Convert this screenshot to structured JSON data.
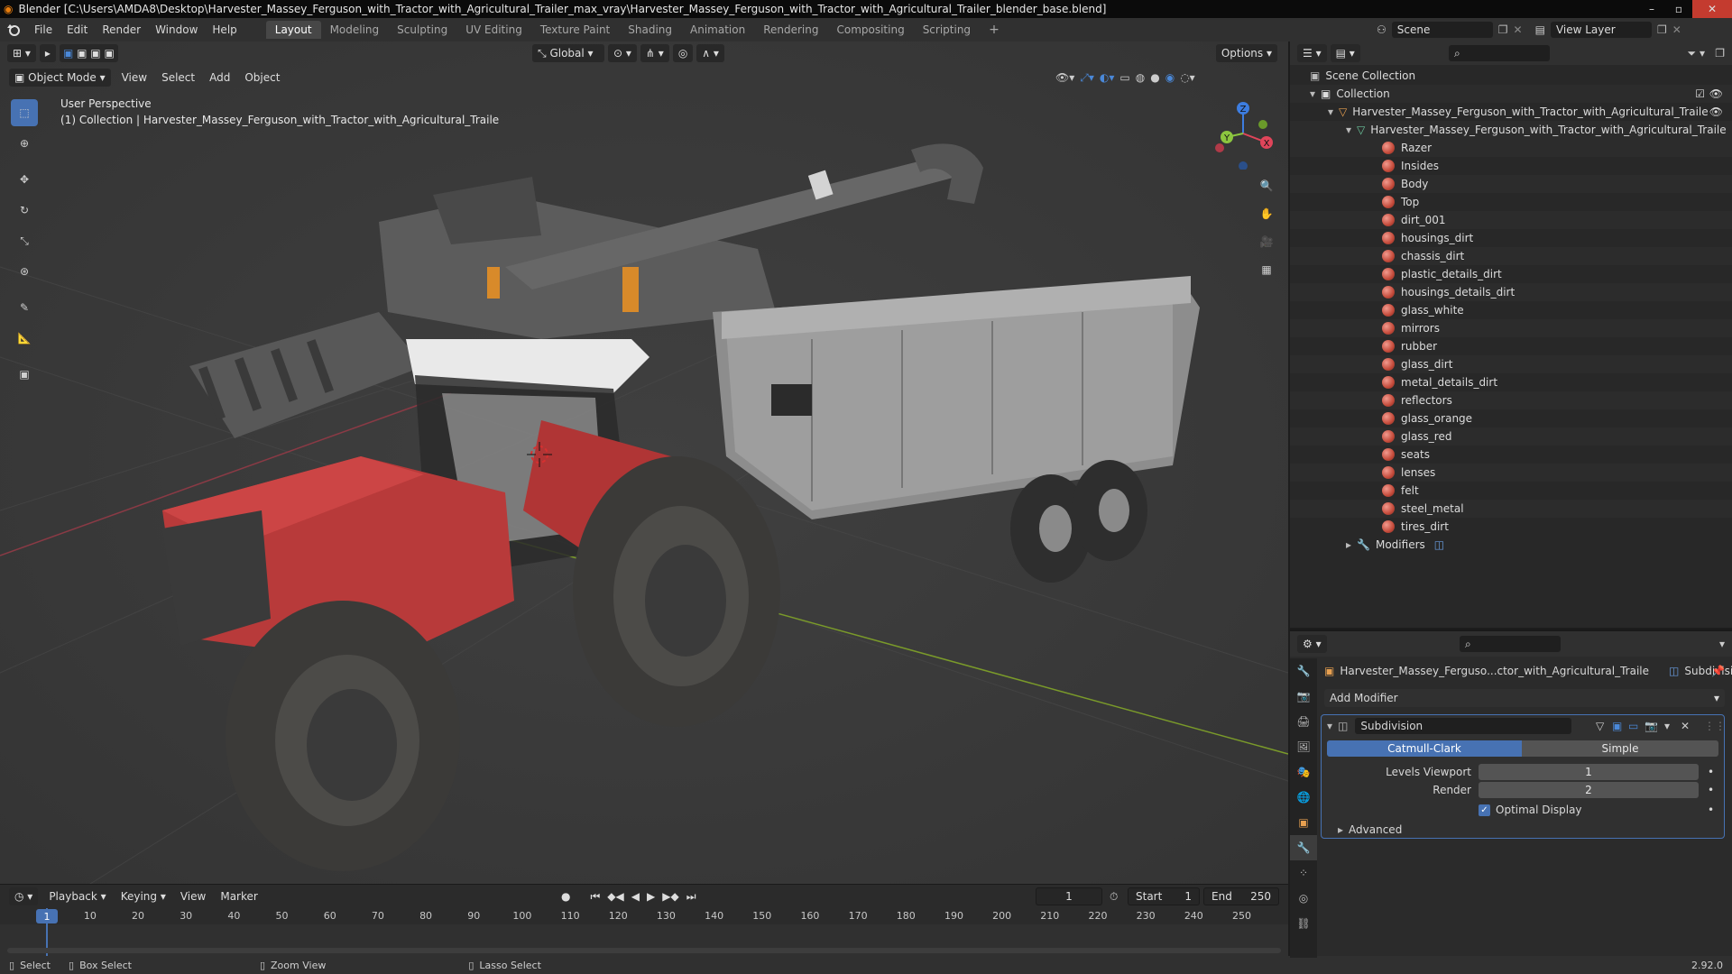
{
  "titlebar": {
    "title": "Blender [C:\\Users\\AMDA8\\Desktop\\Harvester_Massey_Ferguson_with_Tractor_with_Agricultural_Trailer_max_vray\\Harvester_Massey_Ferguson_with_Tractor_with_Agricultural_Trailer_blender_base.blend]"
  },
  "menubar": {
    "menus": [
      "File",
      "Edit",
      "Render",
      "Window",
      "Help"
    ],
    "workspaces": [
      "Layout",
      "Modeling",
      "Sculpting",
      "UV Editing",
      "Texture Paint",
      "Shading",
      "Animation",
      "Rendering",
      "Compositing",
      "Scripting"
    ],
    "active_workspace": "Layout",
    "scene": "Scene",
    "view_layer": "View Layer"
  },
  "viewport": {
    "orientation": "Global",
    "options": "Options",
    "mode": "Object Mode",
    "menus": [
      "View",
      "Select",
      "Add",
      "Object"
    ],
    "perspective": "User Perspective",
    "collection_info": "(1) Collection | Harvester_Massey_Ferguson_with_Tractor_with_Agricultural_Traile",
    "gizmo_axes": [
      "X",
      "Y",
      "Z"
    ]
  },
  "timeline": {
    "menus": [
      "Playback",
      "Keying",
      "View",
      "Marker"
    ],
    "current_frame": "1",
    "start_label": "Start",
    "start": "1",
    "end_label": "End",
    "end": "250",
    "ticks": [
      "1",
      "10",
      "20",
      "30",
      "40",
      "50",
      "60",
      "70",
      "80",
      "90",
      "100",
      "110",
      "120",
      "130",
      "140",
      "150",
      "160",
      "170",
      "180",
      "190",
      "200",
      "210",
      "220",
      "230",
      "240",
      "250"
    ]
  },
  "statusbar": {
    "items": [
      "Select",
      "Box Select",
      "Zoom View",
      "Lasso Select"
    ],
    "version": "2.92.0"
  },
  "outliner": {
    "scene_collection": "Scene Collection",
    "collection": "Collection",
    "object": "Harvester_Massey_Ferguson_with_Tractor_with_Agricultural_Traile",
    "mesh": "Harvester_Massey_Ferguson_with_Tractor_with_Agricultural_Traile",
    "materials": [
      "Razer",
      "Insides",
      "Body",
      "Top",
      "dirt_001",
      "housings_dirt",
      "chassis_dirt",
      "plastic_details_dirt",
      "housings_details_dirt",
      "glass_white",
      "mirrors",
      "rubber",
      "glass_dirt",
      "metal_details_dirt",
      "reflectors",
      "glass_orange",
      "glass_red",
      "seats",
      "lenses",
      "felt",
      "steel_metal",
      "tires_dirt"
    ],
    "modifiers": "Modifiers"
  },
  "properties": {
    "object_name": "Harvester_Massey_Ferguso...ctor_with_Agricultural_Traile",
    "modifier_short": "Subdivisi...",
    "add_modifier": "Add Modifier",
    "modifier_name": "Subdivision",
    "method_catmull": "Catmull-Clark",
    "method_simple": "Simple",
    "levels_viewport_label": "Levels Viewport",
    "levels_viewport": "1",
    "render_label": "Render",
    "render": "2",
    "optimal_display": "Optimal Display",
    "advanced": "Advanced"
  },
  "colors": {
    "accent": "#4772b3",
    "tractor_red": "#b83a3a",
    "x_axis": "#e0455a",
    "y_axis": "#8cc63f",
    "z_axis": "#3d7de0"
  }
}
